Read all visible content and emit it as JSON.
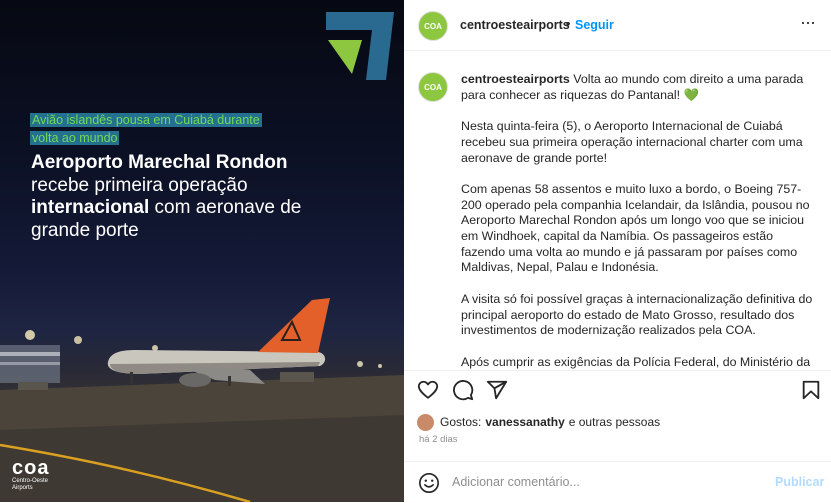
{
  "post_image": {
    "tag_text": "Avião islandês pousa em Cuiabá durante volta ao mundo",
    "headline_bold_1": "Aeroporto Marechal Rondon",
    "headline_text_1": "recebe primeira operação",
    "headline_bold_2": "internacional",
    "headline_text_2": "com aeronave de grande porte",
    "logo_text": "coa",
    "logo_subtext": "Centro-Oeste Airports",
    "colors": {
      "tag_bg": "#26708f",
      "tag_text": "#6fdb57",
      "logo_green": "#8dc63f",
      "logo_blue": "#2a6a90",
      "tail_orange": "#e3602a"
    }
  },
  "header": {
    "avatar_text": "COA",
    "username": "centroesteairports",
    "separator": "•",
    "follow_label": "Seguir",
    "more_icon": "more-horizontal-icon",
    "more_label": "···"
  },
  "caption": {
    "avatar_text": "COA",
    "username": "centroesteairports",
    "intro": "Volta ao mundo com direito a uma parada para conhecer as riquezas do Pantanal! 💚",
    "paragraphs": [
      "Nesta quinta-feira (5), o Aeroporto Internacional de Cuiabá recebeu sua primeira operação internacional charter com uma aeronave de grande porte!",
      "Com apenas 58 assentos e muito luxo a bordo, o Boeing 757-200 operado pela companhia Icelandair, da Islândia, pousou no Aeroporto Marechal Rondon após um longo voo que se iniciou em Windhoek, capital da Namíbia. Os passageiros estão fazendo uma volta ao mundo e já passaram por países como Maldivas, Nepal, Palau e Indonésia.",
      "A visita só foi possível graças à internacionalização definitiva do principal aeroporto do estado de Mato Grosso, resultado dos investimentos de modernização realizados pela COA.",
      "Após cumprir as exigências da Polícia Federal, do Ministério da"
    ]
  },
  "actions": {
    "like_icon": "heart-icon",
    "comment_icon": "comment-icon",
    "share_icon": "share-icon",
    "save_icon": "bookmark-icon"
  },
  "likes": {
    "prefix": "Gostos:",
    "user": "vanessanathy",
    "suffix": "e outras pessoas"
  },
  "time_ago": "há 2 dias",
  "comment_box": {
    "placeholder": "Adicionar comentário...",
    "publish_label": "Publicar",
    "emoji_icon": "emoji-icon"
  }
}
